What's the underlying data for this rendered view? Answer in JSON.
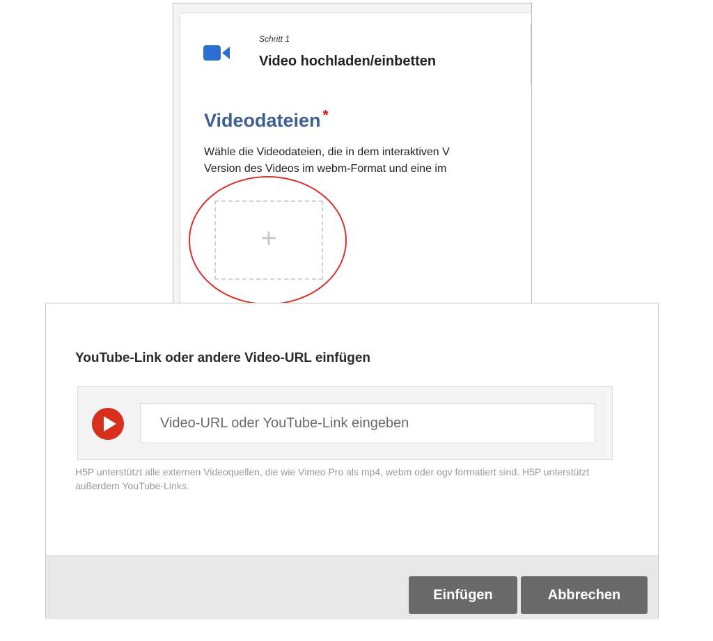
{
  "step": {
    "small_label": "Schritt 1",
    "title": "Video hochladen/einbetten",
    "icon": "video-camera-icon",
    "icon_color": "#2b6fd1"
  },
  "field": {
    "title": "Videodateien",
    "required_mark": "*",
    "description_line1": "Wähle die Videodateien, die in dem interaktiven V",
    "description_line2": "Version des Videos im webm-Format und eine im",
    "add_label": "+"
  },
  "dialog": {
    "title": "YouTube-Link oder andere Video-URL einfügen",
    "input_placeholder": "Video-URL oder YouTube-Link eingeben",
    "input_value": "",
    "help_text": "H5P unterstützt alle externen Videoquellen, die wie Vimeo Pro als mp4, webm oder ogv formatiert sind. H5P unterstützt außerdem YouTube-Links.",
    "insert_label": "Einfügen",
    "cancel_label": "Abbrechen",
    "icon": "youtube-play-icon",
    "icon_color": "#d6301d"
  },
  "colors": {
    "title_blue": "#3d5f94",
    "required_red": "#dd1111",
    "highlight_ellipse": "#d9302a",
    "button_bg": "#6a6a6a",
    "footer_bg": "#e8e8e8"
  }
}
